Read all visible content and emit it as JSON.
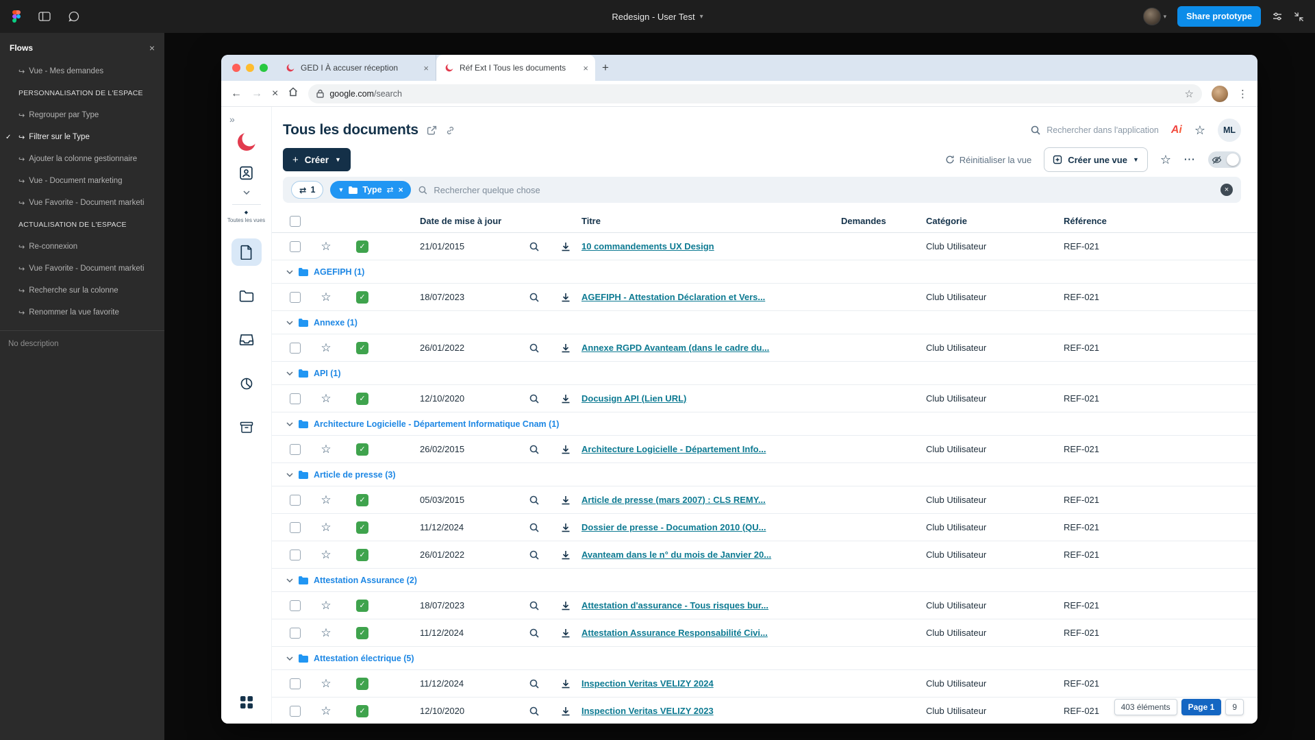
{
  "figma": {
    "topbar": {
      "title": "Redesign - User Test",
      "share_label": "Share prototype"
    },
    "flows": {
      "title": "Flows",
      "items": [
        {
          "label": "Vue - Mes demandes",
          "type": "flow"
        },
        {
          "label": "PERSONNALISATION DE L'ESPACE",
          "type": "section"
        },
        {
          "label": "Regrouper par Type",
          "type": "flow"
        },
        {
          "label": "Filtrer sur le Type",
          "type": "flow",
          "checked": true
        },
        {
          "label": "Ajouter la colonne gestionnaire",
          "type": "flow"
        },
        {
          "label": "Vue - Document marketing",
          "type": "flow"
        },
        {
          "label": "Vue Favorite - Document marketi",
          "type": "flow"
        },
        {
          "label": "ACTUALISATION DE L'ESPACE",
          "type": "section"
        },
        {
          "label": "Re-connexion",
          "type": "flow"
        },
        {
          "label": "Vue Favorite - Document marketi",
          "type": "flow"
        },
        {
          "label": "Recherche sur la colonne",
          "type": "flow"
        },
        {
          "label": "Renommer la vue favorite",
          "type": "flow"
        }
      ],
      "description": "No description"
    }
  },
  "browser": {
    "tabs": [
      {
        "title": "GED I À accuser réception",
        "active": false
      },
      {
        "title": "Réf Ext I Tous les documents",
        "active": true
      }
    ],
    "url": {
      "domain": "google.com",
      "path": "/search"
    }
  },
  "app": {
    "rail": {
      "views_label": "Toutes les vues"
    },
    "header": {
      "title": "Tous les documents",
      "search_placeholder": "Rechercher dans l'application",
      "logo_text": "Ai",
      "avatar_initials": "ML"
    },
    "toolbar": {
      "create_label": "Créer",
      "reset_label": "Réinitialiser la vue",
      "create_view_label": "Créer une vue"
    },
    "filters": {
      "count_chip": "1",
      "type_chip": "Type",
      "search_placeholder": "Rechercher quelque chose"
    },
    "table": {
      "columns": {
        "date": "Date de mise à jour",
        "title": "Titre",
        "requests": "Demandes",
        "category": "Catégorie",
        "reference": "Référence"
      },
      "sections": [
        {
          "rows": [
            {
              "date": "21/01/2015",
              "title": "10 commandements UX Design",
              "category": "Club Utilisateur",
              "reference": "REF-021"
            }
          ]
        },
        {
          "group": "AGEFIPH (1)",
          "rows": [
            {
              "date": "18/07/2023",
              "title": "AGEFIPH - Attestation Déclaration et Vers...",
              "category": "Club Utilisateur",
              "reference": "REF-021"
            }
          ]
        },
        {
          "group": "Annexe (1)",
          "rows": [
            {
              "date": "26/01/2022",
              "title": "Annexe RGPD Avanteam (dans le cadre du...",
              "category": "Club Utilisateur",
              "reference": "REF-021"
            }
          ]
        },
        {
          "group": "API (1)",
          "rows": [
            {
              "date": "12/10/2020",
              "title": "Docusign API (Lien URL)",
              "category": "Club Utilisateur",
              "reference": "REF-021"
            }
          ]
        },
        {
          "group": "Architecture Logicielle - Département Informatique Cnam (1)",
          "rows": [
            {
              "date": "26/02/2015",
              "title": "Architecture Logicielle - Département Info...",
              "category": "Club Utilisateur",
              "reference": "REF-021"
            }
          ]
        },
        {
          "group": "Article de presse (3)",
          "rows": [
            {
              "date": "05/03/2015",
              "title": "Article de presse (mars 2007) : CLS REMY...",
              "category": "Club Utilisateur",
              "reference": "REF-021"
            },
            {
              "date": "11/12/2024",
              "title": "Dossier de presse - Documation 2010 (QU...",
              "category": "Club Utilisateur",
              "reference": "REF-021"
            },
            {
              "date": "26/01/2022",
              "title": "Avanteam dans le n° du mois de Janvier 20...",
              "category": "Club Utilisateur",
              "reference": "REF-021"
            }
          ]
        },
        {
          "group": "Attestation Assurance (2)",
          "rows": [
            {
              "date": "18/07/2023",
              "title": "Attestation d'assurance - Tous risques bur...",
              "category": "Club Utilisateur",
              "reference": "REF-021"
            },
            {
              "date": "11/12/2024",
              "title": "Attestation Assurance Responsabilité Civi...",
              "category": "Club Utilisateur",
              "reference": "REF-021"
            }
          ]
        },
        {
          "group": "Attestation électrique (5)",
          "rows": [
            {
              "date": "11/12/2024",
              "title": "Inspection Veritas VELIZY 2024",
              "category": "Club Utilisateur",
              "reference": "REF-021"
            },
            {
              "date": "12/10/2020",
              "title": "Inspection Veritas VELIZY 2023",
              "category": "Club Utilisateur",
              "reference": "REF-021"
            }
          ]
        }
      ]
    },
    "pagination": {
      "total": "403 éléments",
      "page": "Page 1",
      "last_page": "9"
    }
  },
  "colors": {
    "figma_blue": "#0c8ce9",
    "chip_blue": "#2196f3",
    "group_blue": "#1d87e4",
    "link_teal": "#0d7a92",
    "navy": "#143048",
    "green_check": "#3fa34d",
    "page_badge_blue": "#1466c2"
  }
}
